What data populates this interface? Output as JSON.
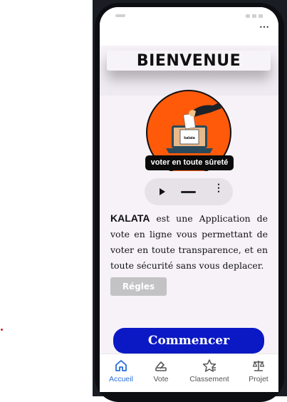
{
  "page": {
    "title": "BIENVENUE",
    "logo_box_text": "kalata",
    "tagline": "voter en toute sûreté",
    "audio_menu_glyph": "⋮",
    "description": {
      "brand": "KALATA",
      "text": " est une Application de vote en ligne vous permettant de voter en toute transparence, et en toute sécurité sans vous deplacer."
    },
    "rules_button": "Régles",
    "start_button": "Commencer"
  },
  "appbar": {
    "menu_glyph": "⋯"
  },
  "nav": {
    "items": [
      {
        "label": "Accueil",
        "icon": "home-icon",
        "active": true
      },
      {
        "label": "Vote",
        "icon": "ballot-icon",
        "active": false
      },
      {
        "label": "Classement",
        "icon": "star-icon",
        "active": false
      },
      {
        "label": "Projet",
        "icon": "scale-icon",
        "active": false
      }
    ]
  },
  "colors": {
    "accent": "#0b19c4",
    "nav_active": "#2a6fd6",
    "logo_orange": "#ff5a0a",
    "rules_button": "#c3c3c5"
  }
}
